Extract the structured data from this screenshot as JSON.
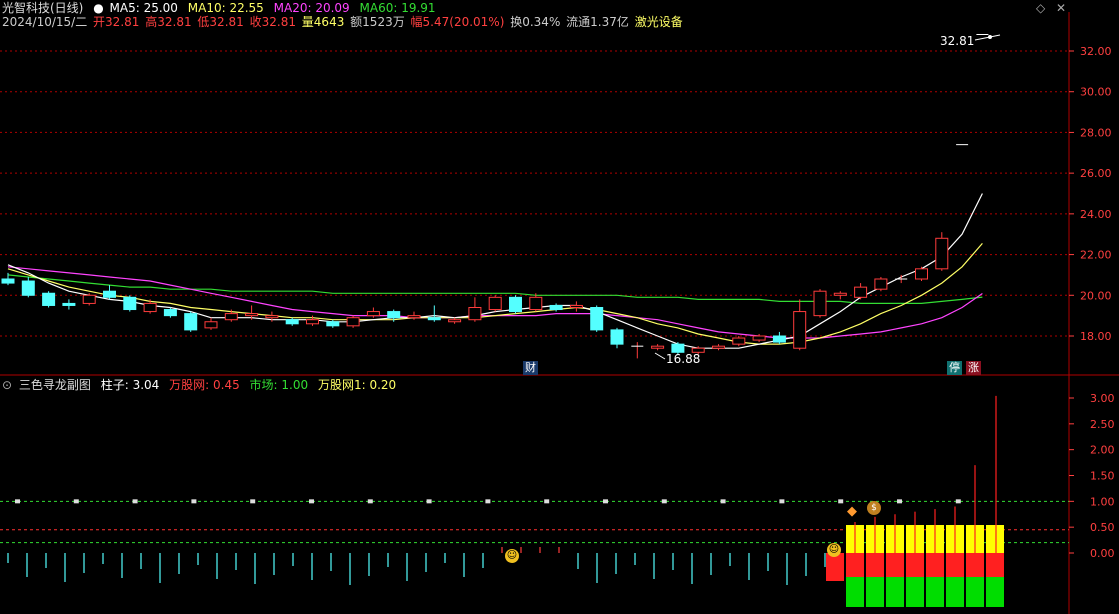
{
  "header": {
    "stock_name": "光智科技(日线)",
    "ma5": "MA5: 25.00",
    "ma10": "MA10: 22.55",
    "ma20": "MA20: 20.09",
    "ma60": "MA60: 19.91",
    "date": "2024/10/15/二",
    "open": "开32.81",
    "high": "高32.81",
    "low": "低32.81",
    "close": "收32.81",
    "volume": "量4643",
    "amount": "额1523万",
    "change": "幅5.47(20.01%)",
    "turnover": "换0.34%",
    "float_cap": "流通1.37亿",
    "sector": "激光设备"
  },
  "price_axis": {
    "ticks": [
      "32.00",
      "30.00",
      "28.00",
      "26.00",
      "24.00",
      "22.00",
      "20.00",
      "18.00"
    ],
    "tick_values": [
      32,
      30,
      28,
      26,
      24,
      22,
      20,
      18
    ]
  },
  "annotations": {
    "last_price": "32.81",
    "low_label": "16.88",
    "badge_cai": "财",
    "badge_ting": "停",
    "badge_zhang": "涨"
  },
  "sub": {
    "title": "三色寻龙副图",
    "zhuzi": "柱子: 3.04",
    "wgw": "万股网: 0.45",
    "shichang": "市场: 1.00",
    "wgw1": "万股网1: 0.20",
    "ticks": [
      "3.00",
      "2.50",
      "2.00",
      "1.50",
      "1.00",
      "0.50",
      "0.00"
    ],
    "tick_values": [
      3.0,
      2.5,
      2.0,
      1.5,
      1.0,
      0.5,
      0.0
    ]
  },
  "colors": {
    "up": "#ff3c3c",
    "down": "#54ffff",
    "ma5": "#ffffff",
    "ma10": "#ffff66",
    "ma20": "#ff44ff",
    "ma60": "#33dd33",
    "grid": "#b00000",
    "axis": "#ff4040",
    "sub_yellow": "#ffff00",
    "sub_green": "#00dd00",
    "sub_red": "#ff2020"
  },
  "chart_data": {
    "type": "candlestick",
    "ylim": [
      17,
      33.5
    ],
    "candles": [
      {
        "o": 20.8,
        "c": 20.6,
        "h": 21.1,
        "l": 20.5
      },
      {
        "o": 20.7,
        "c": 20.0,
        "h": 20.9,
        "l": 19.9
      },
      {
        "o": 20.1,
        "c": 19.5,
        "h": 20.2,
        "l": 19.4
      },
      {
        "o": 19.6,
        "c": 19.5,
        "h": 19.8,
        "l": 19.3
      },
      {
        "o": 19.6,
        "c": 20.0,
        "h": 20.1,
        "l": 19.5
      },
      {
        "o": 20.2,
        "c": 19.9,
        "h": 20.5,
        "l": 19.8
      },
      {
        "o": 19.9,
        "c": 19.3,
        "h": 20.0,
        "l": 19.2
      },
      {
        "o": 19.2,
        "c": 19.6,
        "h": 19.8,
        "l": 19.1
      },
      {
        "o": 19.3,
        "c": 19.0,
        "h": 19.4,
        "l": 18.9
      },
      {
        "o": 19.1,
        "c": 18.3,
        "h": 19.2,
        "l": 18.2
      },
      {
        "o": 18.4,
        "c": 18.7,
        "h": 18.9,
        "l": 18.3
      },
      {
        "o": 18.8,
        "c": 19.1,
        "h": 19.3,
        "l": 18.7
      },
      {
        "o": 19.0,
        "c": 19.1,
        "h": 19.5,
        "l": 18.8
      },
      {
        "o": 18.9,
        "c": 19.0,
        "h": 19.2,
        "l": 18.7
      },
      {
        "o": 18.8,
        "c": 18.6,
        "h": 18.9,
        "l": 18.5
      },
      {
        "o": 18.6,
        "c": 18.8,
        "h": 19.0,
        "l": 18.5
      },
      {
        "o": 18.7,
        "c": 18.5,
        "h": 18.8,
        "l": 18.4
      },
      {
        "o": 18.5,
        "c": 18.9,
        "h": 19.0,
        "l": 18.4
      },
      {
        "o": 19.0,
        "c": 19.2,
        "h": 19.4,
        "l": 18.9
      },
      {
        "o": 19.2,
        "c": 18.9,
        "h": 19.3,
        "l": 18.7
      },
      {
        "o": 18.9,
        "c": 19.0,
        "h": 19.2,
        "l": 18.8
      },
      {
        "o": 18.9,
        "c": 18.8,
        "h": 19.5,
        "l": 18.7
      },
      {
        "o": 18.7,
        "c": 18.8,
        "h": 18.9,
        "l": 18.6
      },
      {
        "o": 18.8,
        "c": 19.4,
        "h": 19.9,
        "l": 18.7
      },
      {
        "o": 19.3,
        "c": 19.9,
        "h": 20.0,
        "l": 19.2
      },
      {
        "o": 19.9,
        "c": 19.2,
        "h": 20.0,
        "l": 19.1
      },
      {
        "o": 19.3,
        "c": 19.9,
        "h": 20.1,
        "l": 19.2
      },
      {
        "o": 19.5,
        "c": 19.3,
        "h": 19.6,
        "l": 19.2
      },
      {
        "o": 19.4,
        "c": 19.5,
        "h": 19.7,
        "l": 19.2
      },
      {
        "o": 19.4,
        "c": 18.3,
        "h": 19.5,
        "l": 18.2
      },
      {
        "o": 18.3,
        "c": 17.6,
        "h": 18.4,
        "l": 17.4
      },
      {
        "o": 17.5,
        "c": 17.5,
        "h": 17.7,
        "l": 16.9
      },
      {
        "o": 17.4,
        "c": 17.5,
        "h": 17.6,
        "l": 17.3
      },
      {
        "o": 17.6,
        "c": 17.2,
        "h": 17.7,
        "l": 17.1
      },
      {
        "o": 17.2,
        "c": 17.4,
        "h": 17.5,
        "l": 17.1
      },
      {
        "o": 17.4,
        "c": 17.5,
        "h": 17.6,
        "l": 17.3
      },
      {
        "o": 17.6,
        "c": 17.9,
        "h": 18.0,
        "l": 17.5
      },
      {
        "o": 17.8,
        "c": 18.0,
        "h": 18.1,
        "l": 17.7
      },
      {
        "o": 18.0,
        "c": 17.7,
        "h": 18.2,
        "l": 17.6
      },
      {
        "o": 17.4,
        "c": 19.2,
        "h": 19.8,
        "l": 17.3
      },
      {
        "o": 19.0,
        "c": 20.2,
        "h": 20.3,
        "l": 18.9
      },
      {
        "o": 20.0,
        "c": 20.1,
        "h": 20.2,
        "l": 19.8
      },
      {
        "o": 19.9,
        "c": 20.4,
        "h": 20.6,
        "l": 19.8
      },
      {
        "o": 20.3,
        "c": 20.8,
        "h": 20.9,
        "l": 20.2
      },
      {
        "o": 20.8,
        "c": 20.8,
        "h": 21.0,
        "l": 20.6
      },
      {
        "o": 20.8,
        "c": 21.3,
        "h": 21.4,
        "l": 20.7
      },
      {
        "o": 21.3,
        "c": 22.8,
        "h": 23.1,
        "l": 21.2
      },
      {
        "o": 27.4,
        "c": 27.4,
        "h": 27.4,
        "l": 27.4
      },
      {
        "o": 32.81,
        "c": 32.81,
        "h": 32.81,
        "l": 32.81
      }
    ],
    "ma5": [
      21.5,
      21.1,
      20.6,
      20.2,
      20.0,
      19.8,
      19.7,
      19.5,
      19.4,
      19.2,
      18.9,
      18.9,
      18.9,
      18.8,
      18.8,
      18.8,
      18.7,
      18.7,
      18.8,
      18.9,
      18.9,
      19.0,
      18.9,
      19.0,
      19.2,
      19.3,
      19.4,
      19.5,
      19.5,
      19.2,
      18.8,
      18.4,
      18.0,
      17.6,
      17.4,
      17.4,
      17.4,
      17.6,
      17.8,
      18.0,
      18.6,
      19.2,
      19.9,
      20.4,
      20.9,
      21.3,
      21.9,
      23.0,
      25.0
    ],
    "ma10": [
      21.3,
      21.0,
      20.7,
      20.4,
      20.2,
      20.0,
      19.9,
      19.7,
      19.6,
      19.4,
      19.3,
      19.2,
      19.1,
      19.0,
      18.9,
      18.9,
      18.8,
      18.8,
      18.8,
      18.8,
      18.9,
      18.9,
      18.9,
      18.9,
      19.0,
      19.1,
      19.2,
      19.3,
      19.4,
      19.3,
      19.1,
      18.9,
      18.6,
      18.4,
      18.1,
      17.9,
      17.7,
      17.6,
      17.6,
      17.7,
      17.9,
      18.2,
      18.6,
      19.1,
      19.5,
      20.0,
      20.6,
      21.4,
      22.55
    ],
    "ma20": [
      21.4,
      21.3,
      21.2,
      21.1,
      21.0,
      20.9,
      20.8,
      20.7,
      20.5,
      20.3,
      20.1,
      19.9,
      19.7,
      19.5,
      19.3,
      19.2,
      19.1,
      19.0,
      19.0,
      19.0,
      18.9,
      18.9,
      18.9,
      19.0,
      19.0,
      19.0,
      19.0,
      19.1,
      19.1,
      19.1,
      19.0,
      18.9,
      18.8,
      18.6,
      18.4,
      18.2,
      18.1,
      18.0,
      17.9,
      17.9,
      17.9,
      18.0,
      18.1,
      18.2,
      18.4,
      18.6,
      18.9,
      19.4,
      20.09
    ],
    "ma60": [
      21.0,
      20.9,
      20.8,
      20.7,
      20.6,
      20.5,
      20.4,
      20.4,
      20.3,
      20.3,
      20.3,
      20.2,
      20.2,
      20.2,
      20.2,
      20.2,
      20.1,
      20.1,
      20.1,
      20.1,
      20.1,
      20.1,
      20.1,
      20.1,
      20.1,
      20.1,
      20.0,
      20.0,
      20.0,
      20.0,
      20.0,
      19.9,
      19.9,
      19.9,
      19.8,
      19.8,
      19.8,
      19.8,
      19.7,
      19.7,
      19.7,
      19.7,
      19.6,
      19.6,
      19.6,
      19.6,
      19.7,
      19.8,
      19.91
    ],
    "sub_lines": [
      {
        "name": "柱子",
        "value": 3.04
      },
      {
        "name": "万股网",
        "value": 0.45
      },
      {
        "name": "市场",
        "value": 1.0
      },
      {
        "name": "万股网1",
        "value": 0.2
      }
    ]
  }
}
